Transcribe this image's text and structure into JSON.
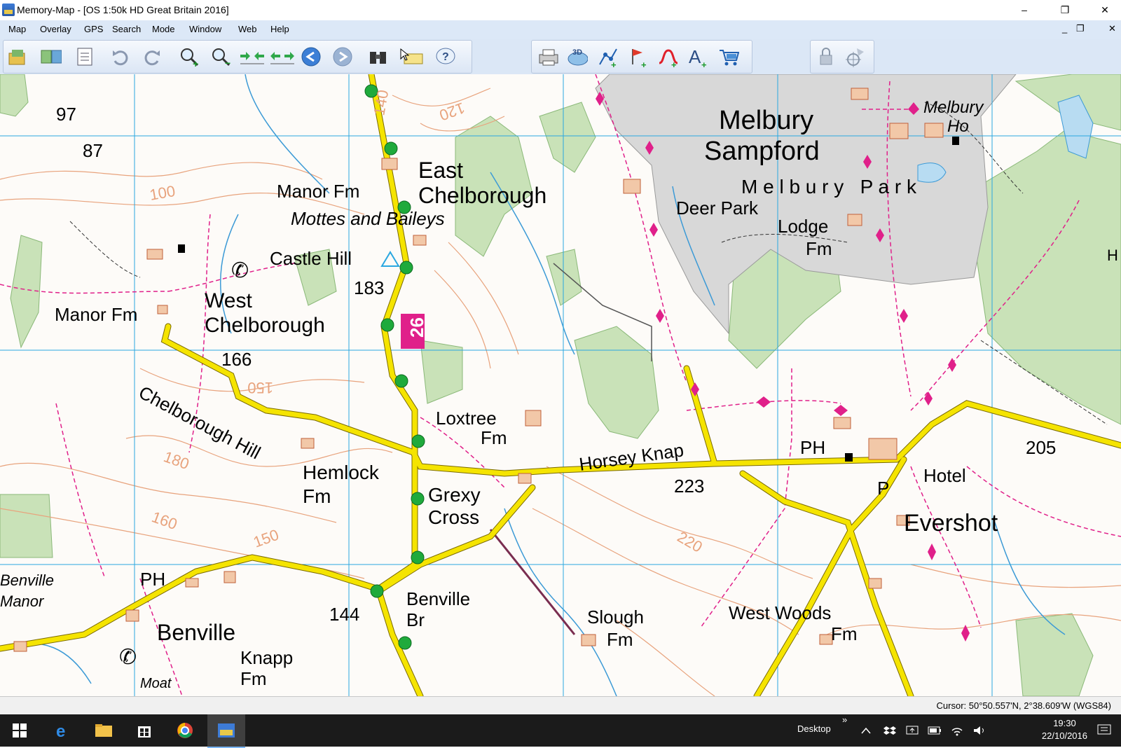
{
  "window": {
    "title": "Memory-Map - [OS 1:50k HD Great Britain 2016]",
    "minimize_glyph": "–",
    "maximize_glyph": "❐",
    "close_glyph": "✕",
    "mdi_minimize": "_",
    "mdi_restore": "❐",
    "mdi_close": "✕"
  },
  "menu": [
    "Map",
    "Overlay",
    "GPS",
    "Search",
    "Mode",
    "Window",
    "Web",
    "Help"
  ],
  "toolbar": {
    "icons": [
      "open-map-icon",
      "map-list-icon",
      "properties-icon",
      "undo-icon",
      "redo-icon",
      "zoom-in-icon",
      "zoom-out-icon",
      "scale-in-icon",
      "scale-out-icon",
      "back-icon",
      "forward-icon",
      "binoculars-icon",
      "select-area-icon",
      "help-icon",
      "print-icon",
      "3d-view-icon",
      "new-route-icon",
      "new-mark-icon",
      "new-track-icon",
      "new-text-icon",
      "shop-icon",
      "lock-icon",
      "gps-icon"
    ]
  },
  "map": {
    "labels": {
      "melbury_sampford_1": "Melbury",
      "melbury_sampford_2": "Sampford",
      "melbury_ho_1": "Melbury",
      "melbury_ho_2": "Ho",
      "melbury_park": "M e l b u r y   P a r k",
      "deer_park": "Deer Park",
      "lodge_fm_1": "Lodge",
      "lodge_fm_2": "Fm",
      "east_chelborough_1": "East",
      "east_chelborough_2": "Chelborough",
      "manor_fm_north": "Manor Fm",
      "mottes": "Mottes and Baileys",
      "castle_hill": "Castle Hill",
      "h183": "183",
      "west_chelborough_1": "West",
      "west_chelborough_2": "Chelborough",
      "manor_fm_west": "Manor Fm",
      "h166": "166",
      "h97": "97",
      "h87": "87",
      "c100": "100",
      "c120": "120",
      "c140": "140",
      "c150a": "150",
      "c150b": "150",
      "c160": "160",
      "c180": "180",
      "c220": "220",
      "route_26": "26",
      "loxtree_1": "Loxtree",
      "loxtree_2": "Fm",
      "horsey_knap": "Horsey Knap",
      "h223": "223",
      "chelborough_hill": "Chelborough Hill",
      "hemlock_1": "Hemlock",
      "hemlock_2": "Fm",
      "grexy_1": "Grexy",
      "grexy_2": "Cross",
      "ph_east": "PH",
      "hotel": "Hotel",
      "p": "P",
      "evershot": "Evershot",
      "h205": "205",
      "benville_manor_1": "Benville",
      "benville_manor_2": "Manor",
      "ph_west": "PH",
      "benville": "Benville",
      "h144": "144",
      "benville_br_1": "Benville",
      "benville_br_2": "Br",
      "knapp_1": "Knapp",
      "knapp_2": "Fm",
      "slough_1": "Slough",
      "slough_2": "Fm",
      "west_woods_1": "West Woods",
      "west_woods_2": "Fm",
      "moat": "Moat",
      "h_edge": "H"
    }
  },
  "status": {
    "cursor": "Cursor: 50°50.557'N, 2°38.609'W (WGS84)"
  },
  "taskbar": {
    "desktop": "Desktop",
    "chevron": "»",
    "time": "19:30",
    "date": "22/10/2016"
  },
  "colors": {
    "grid": "#2aa7e0",
    "road": "#f5e400",
    "contour": "#e8a37d",
    "woodland": "#c9e2b8",
    "park": "#d8d8d8",
    "path": "#e0208a",
    "route_node": "#1faa3c"
  }
}
